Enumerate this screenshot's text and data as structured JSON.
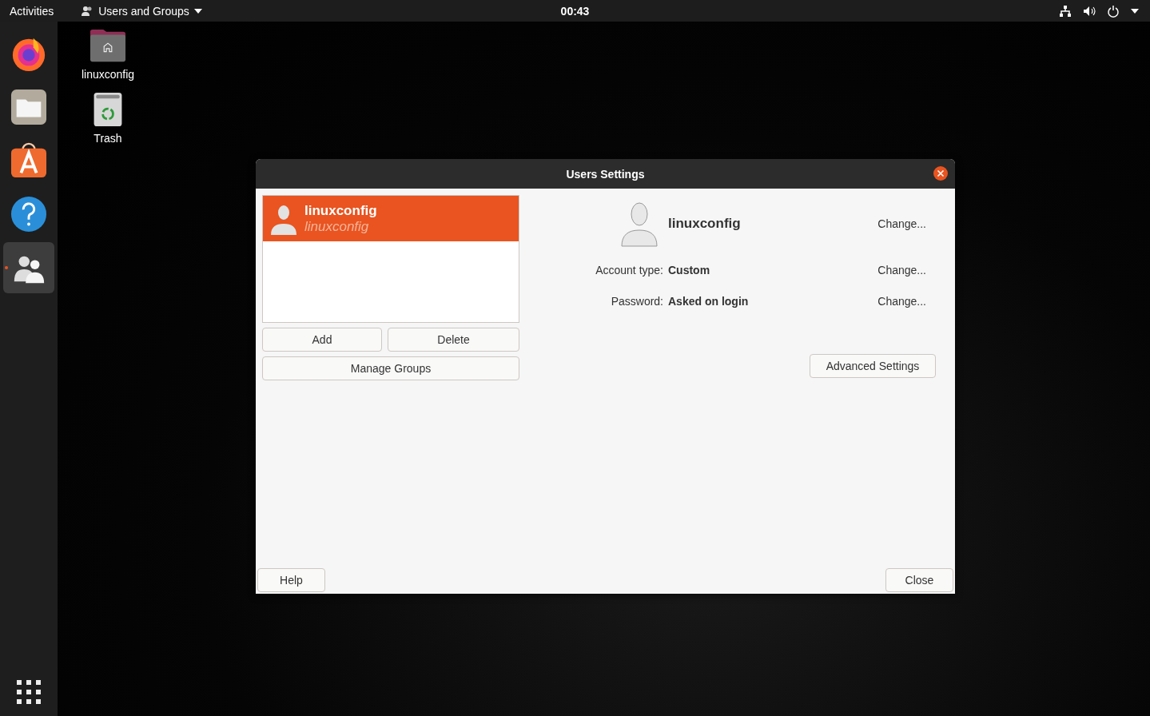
{
  "top_bar": {
    "activities": "Activities",
    "app_menu": "Users and Groups",
    "clock": "00:43"
  },
  "dock": {
    "items": [
      {
        "kind": "firefox",
        "active": false
      },
      {
        "kind": "files",
        "active": false
      },
      {
        "kind": "software",
        "active": false
      },
      {
        "kind": "help",
        "active": false
      },
      {
        "kind": "users",
        "active": true
      }
    ]
  },
  "desktop_icons": [
    {
      "kind": "home",
      "label": "linuxconfig"
    },
    {
      "kind": "trash",
      "label": "Trash"
    }
  ],
  "dialog": {
    "title": "Users Settings",
    "users": [
      {
        "name": "linuxconfig",
        "login": "linuxconfig",
        "selected": true
      }
    ],
    "add": "Add",
    "delete": "Delete",
    "manage_groups": "Manage Groups",
    "user_name": "linuxconfig",
    "name_action": "Change...",
    "fields": [
      {
        "label": "Account type:",
        "value": "Custom",
        "action": "Change..."
      },
      {
        "label": "Password:",
        "value": "Asked on login",
        "action": "Change..."
      }
    ],
    "advanced": "Advanced Settings",
    "help": "Help",
    "close": "Close"
  }
}
